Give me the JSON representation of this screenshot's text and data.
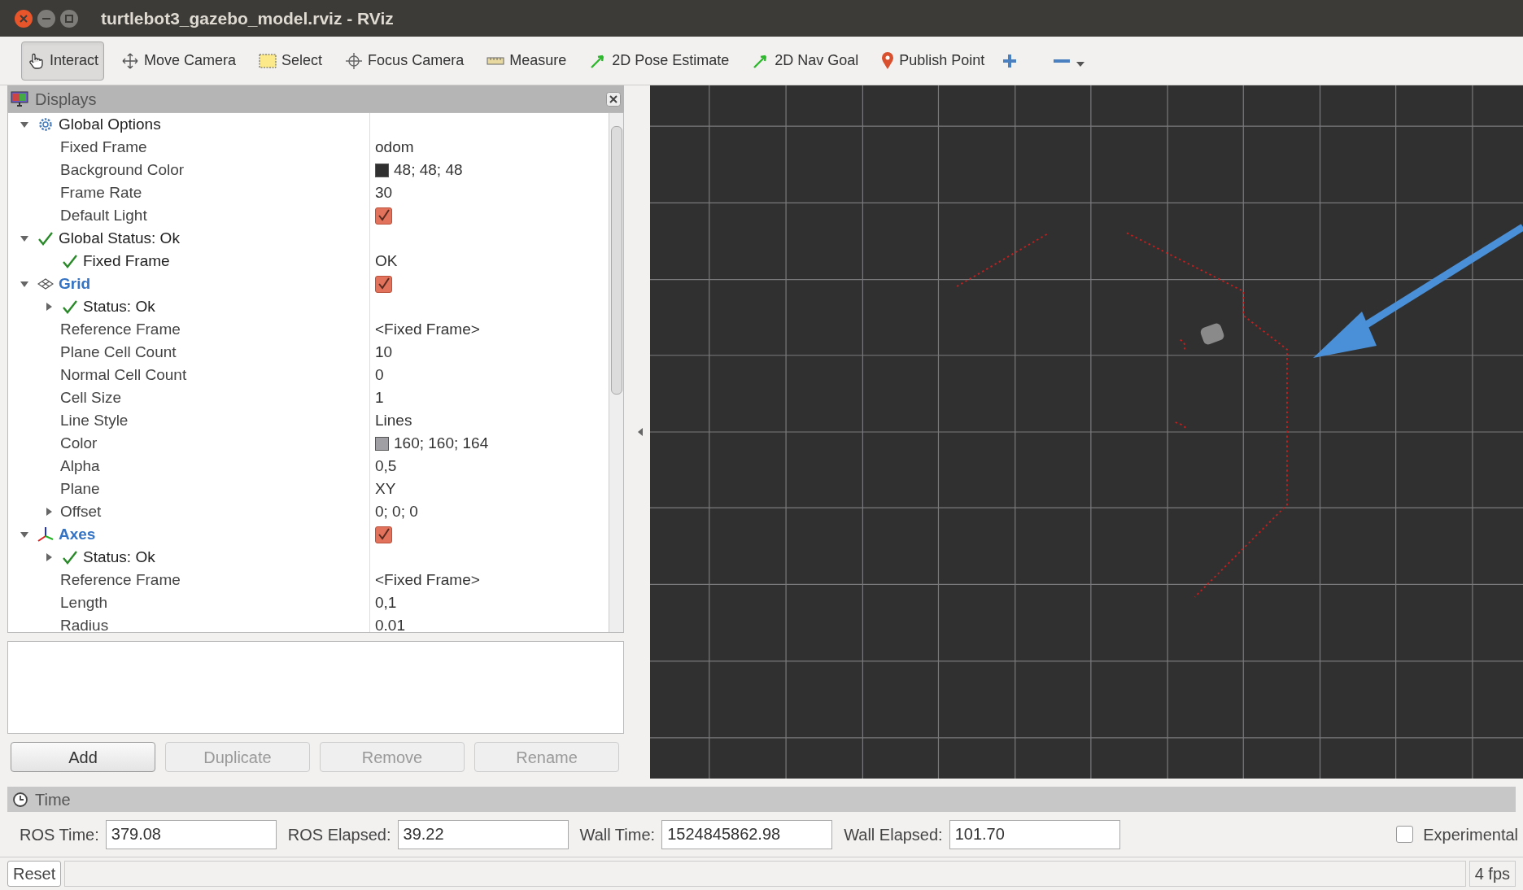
{
  "window": {
    "title": "turtlebot3_gazebo_model.rviz - RViz"
  },
  "toolbar": [
    {
      "label": "Interact",
      "kind": "hand",
      "selected": true
    },
    {
      "label": "Move Camera",
      "kind": "move",
      "selected": false
    },
    {
      "label": "Select",
      "kind": "select",
      "selected": false
    },
    {
      "label": "Focus Camera",
      "kind": "focus",
      "selected": false
    },
    {
      "label": "Measure",
      "kind": "ruler",
      "selected": false
    },
    {
      "label": "2D Pose Estimate",
      "kind": "pose",
      "selected": false
    },
    {
      "label": "2D Nav Goal",
      "kind": "pose",
      "selected": false
    },
    {
      "label": "Publish Point",
      "kind": "pin",
      "selected": false
    }
  ],
  "displays": {
    "title": "Displays",
    "tree": [
      {
        "label": "Global Options",
        "kind": "options",
        "expanded": true,
        "children": [
          {
            "label": "Fixed Frame",
            "kind": "property",
            "value": "odom"
          },
          {
            "label": "Background Color",
            "kind": "property",
            "value": "48; 48; 48",
            "color": "#303030"
          },
          {
            "label": "Frame Rate",
            "kind": "property",
            "value": "30"
          },
          {
            "label": "Default Light",
            "kind": "property",
            "checked": true
          }
        ]
      },
      {
        "label": "Global Status: Ok",
        "kind": "status",
        "expanded": true,
        "children": [
          {
            "label": "Fixed Frame",
            "kind": "status",
            "value": "OK"
          }
        ]
      },
      {
        "label": "Grid",
        "kind": "grid",
        "checked": true,
        "expanded": true,
        "children": [
          {
            "label": "Status: Ok",
            "kind": "status",
            "expanded": false
          },
          {
            "label": "Reference Frame",
            "kind": "property",
            "value": "<Fixed Frame>"
          },
          {
            "label": "Plane Cell Count",
            "kind": "property",
            "value": "10"
          },
          {
            "label": "Normal Cell Count",
            "kind": "property",
            "value": "0"
          },
          {
            "label": "Cell Size",
            "kind": "property",
            "value": "1"
          },
          {
            "label": "Line Style",
            "kind": "property",
            "value": "Lines"
          },
          {
            "label": "Color",
            "kind": "property",
            "value": "160; 160; 164",
            "color": "#a0a0a4"
          },
          {
            "label": "Alpha",
            "kind": "property",
            "value": "0,5"
          },
          {
            "label": "Plane",
            "kind": "property",
            "value": "XY"
          },
          {
            "label": "Offset",
            "kind": "property",
            "value": "0; 0; 0",
            "expanded": false
          }
        ]
      },
      {
        "label": "Axes",
        "kind": "axes",
        "checked": true,
        "expanded": true,
        "children": [
          {
            "label": "Status: Ok",
            "kind": "status",
            "expanded": false
          },
          {
            "label": "Reference Frame",
            "kind": "property",
            "value": "<Fixed Frame>"
          },
          {
            "label": "Length",
            "kind": "property",
            "value": "0,1"
          },
          {
            "label": "Radius",
            "kind": "property",
            "value": "0.01"
          }
        ]
      }
    ],
    "buttons": [
      {
        "label": "Add",
        "disabled": false
      },
      {
        "label": "Duplicate",
        "disabled": true
      },
      {
        "label": "Remove",
        "disabled": true
      },
      {
        "label": "Rename",
        "disabled": true
      }
    ]
  },
  "time": {
    "title": "Time",
    "fields": [
      {
        "label": "ROS Time:",
        "value": "379.08"
      },
      {
        "label": "ROS Elapsed:",
        "value": "39.22"
      },
      {
        "label": "Wall Time:",
        "value": "1524845862.98"
      },
      {
        "label": "Wall Elapsed:",
        "value": "101.70"
      }
    ],
    "experimental": {
      "label": "Experimental",
      "checked": false
    }
  },
  "status_bar": {
    "reset": "Reset",
    "fps": "4 fps"
  }
}
